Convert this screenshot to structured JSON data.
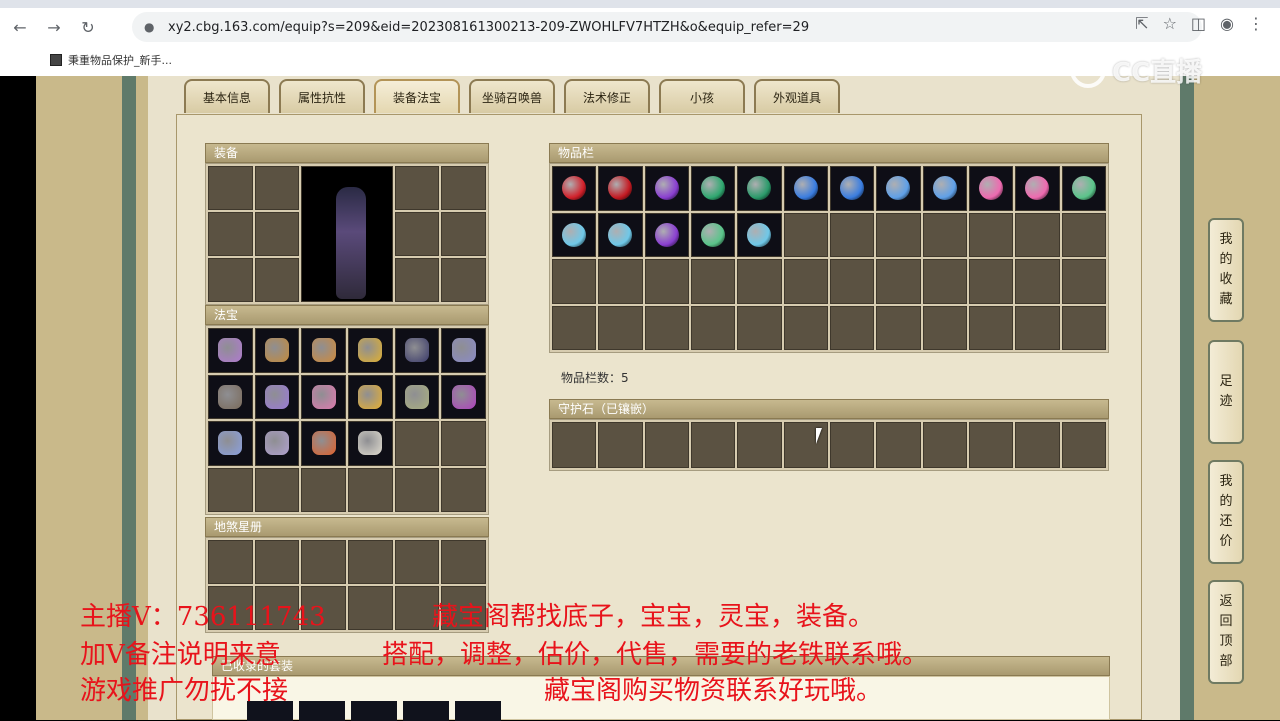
{
  "browser": {
    "url": "xy2.cbg.163.com/equip?s=209&eid=202308161300213-209-ZWOHLFV7HTZH&o&equip_refer=29",
    "bookmark": "秉重物品保护_新手...",
    "watermark": "CC直播"
  },
  "tabs": [
    "基本信息",
    "属性抗性",
    "装备法宝",
    "坐骑召唤兽",
    "法术修正",
    "小孩",
    "外观道具"
  ],
  "active_tab": "装备法宝",
  "sections": {
    "equipment": "装备",
    "fabao": "法宝",
    "disha": "地煞星册",
    "inventory": "物品栏",
    "inventory_count": "物品栏数：5",
    "guard_stone": "守护石（已镶嵌）",
    "collected": "已收录的套装"
  },
  "inventory_colors": [
    "#d2202a",
    "#c41a22",
    "#8a3fd1",
    "#2fa870",
    "#2a9a6a",
    "#3a7de0",
    "#3a7de0",
    "#5fa0e8",
    "#5fa0e8",
    "#ee6ab0",
    "#ee6ab0",
    "#5ac48a",
    "#6fc8e8",
    "#6fc8e8",
    "#8a3fd1",
    "#5ac48a",
    "#6fc8e8"
  ],
  "fabao_colors": [
    "#b07ad0",
    "#c48a3a",
    "#d08a3a",
    "#e0b030",
    "#3a3a6a",
    "#8a8ac8",
    "#7a6a5a",
    "#9a7ad8",
    "#e07ab0",
    "#e8b030",
    "#aab080",
    "#b040c0",
    "#8aa0e0",
    "#b0a0d0",
    "#e0602a",
    "#e0dcd0"
  ],
  "side_tabs": [
    {
      "label": "我的收藏",
      "chars": [
        "我",
        "的",
        "收",
        "藏"
      ]
    },
    {
      "label": "足迹",
      "chars": [
        "足",
        "迹"
      ]
    },
    {
      "label": "我的还价",
      "chars": [
        "我",
        "的",
        "还",
        "价"
      ]
    },
    {
      "label": "返回顶部",
      "chars": [
        "返",
        "回",
        "顶",
        "部"
      ]
    }
  ],
  "overlay": {
    "line1a": "主播V：736111743",
    "line1b": "藏宝阁帮找底子，宝宝，灵宝，装备。",
    "line2a": "加V备注说明来意",
    "line2b": "搭配，调整，估价，代售，需要的老铁联系哦。",
    "line3a": "游戏推广勿扰不接",
    "line3b": "藏宝阁购买物资联系好玩哦。"
  }
}
